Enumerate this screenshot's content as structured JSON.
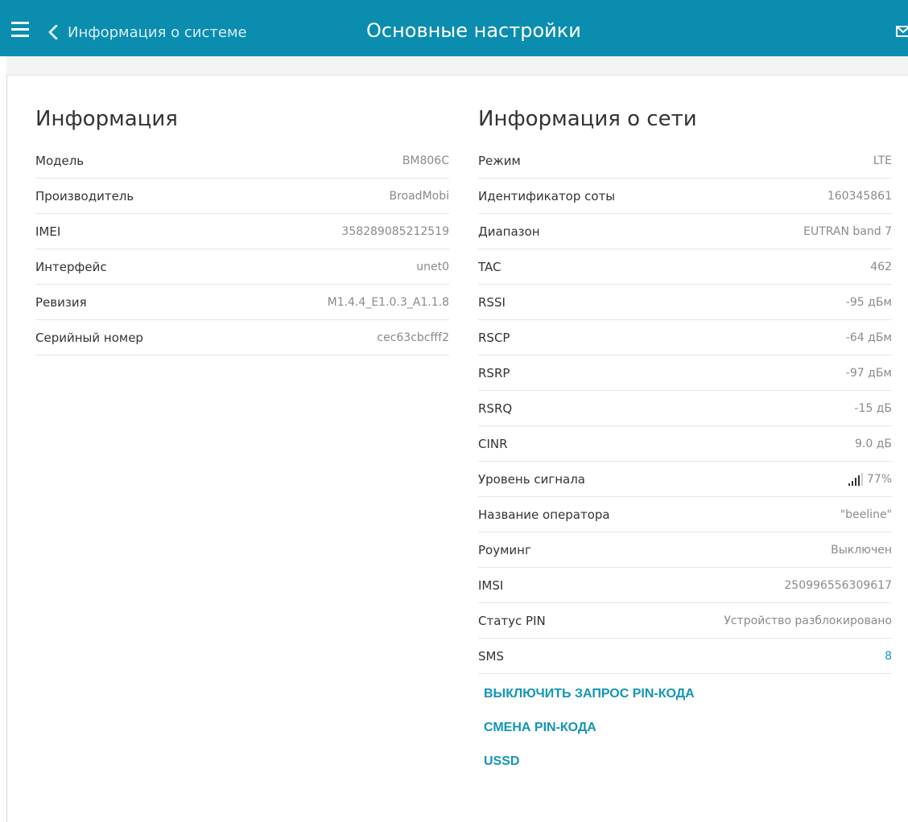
{
  "header": {
    "menu_icon": "hamburger-menu-icon",
    "back_label": "Информация о системе",
    "title": "Основные настройки",
    "mail_icon": "mail-icon",
    "background_color": "#0b8db0"
  },
  "info": {
    "title": "Информация",
    "rows": [
      {
        "label": "Модель",
        "value": "BM806C"
      },
      {
        "label": "Производитель",
        "value": "BroadMobi"
      },
      {
        "label": "IMEI",
        "value": "358289085212519"
      },
      {
        "label": "Интерфейс",
        "value": "unet0"
      },
      {
        "label": "Ревизия",
        "value": "M1.4.4_E1.0.3_A1.1.8"
      },
      {
        "label": "Серийный номер",
        "value": "cec63cbcfff2"
      }
    ]
  },
  "network": {
    "title": "Информация о сети",
    "rows": [
      {
        "label": "Режим",
        "value": "LTE"
      },
      {
        "label": "Идентификатор соты",
        "value": "160345861"
      },
      {
        "label": "Диапазон",
        "value": "EUTRAN band 7"
      },
      {
        "label": "TAC",
        "value": "462"
      },
      {
        "label": "RSSI",
        "value": "-95 дБм"
      },
      {
        "label": "RSCP",
        "value": "-64 дБм"
      },
      {
        "label": "RSRP",
        "value": "-97 дБм"
      },
      {
        "label": "RSRQ",
        "value": "-15 дБ"
      },
      {
        "label": "CINR",
        "value": "9.0 дБ"
      },
      {
        "label": "Уровень сигнала",
        "value": "77%"
      },
      {
        "label": "Название оператора",
        "value": "\"beeline\""
      },
      {
        "label": "Роуминг",
        "value": "Выключен"
      },
      {
        "label": "IMSI",
        "value": "250996556309617"
      },
      {
        "label": "Статус PIN",
        "value": "Устройство разблокировано"
      },
      {
        "label": "SMS",
        "value": "8"
      }
    ],
    "signal": {
      "icon": "signal-strength-icon",
      "bars_active": 4,
      "bars_total": 5
    }
  },
  "actions": [
    "ВЫКЛЮЧИТЬ ЗАПРОС PIN-КОДА",
    "СМЕНА PIN-КОДА",
    "USSD"
  ],
  "colors": {
    "accent": "#1295b8",
    "link": "#1a8fd1",
    "text": "#333333",
    "muted": "#8a8a8a"
  }
}
